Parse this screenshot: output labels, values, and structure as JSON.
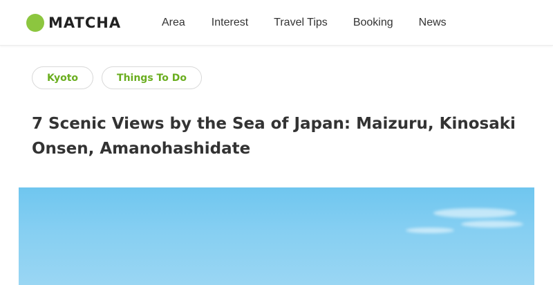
{
  "header": {
    "logo_text": "MATCHA",
    "logo_color": "#8cc63f",
    "nav": [
      {
        "label": "Area"
      },
      {
        "label": "Interest"
      },
      {
        "label": "Travel Tips"
      },
      {
        "label": "Booking"
      },
      {
        "label": "News"
      }
    ]
  },
  "article": {
    "tags": [
      {
        "label": "Kyoto"
      },
      {
        "label": "Things To Do"
      }
    ],
    "title": "7 Scenic Views by the Sea of Japan: Maizuru, Kinosaki Onsen, Amanohashidate"
  },
  "colors": {
    "accent": "#8cc63f",
    "tag_text": "#6aae1f",
    "text": "#333333",
    "sky": "#7fcbf0"
  }
}
